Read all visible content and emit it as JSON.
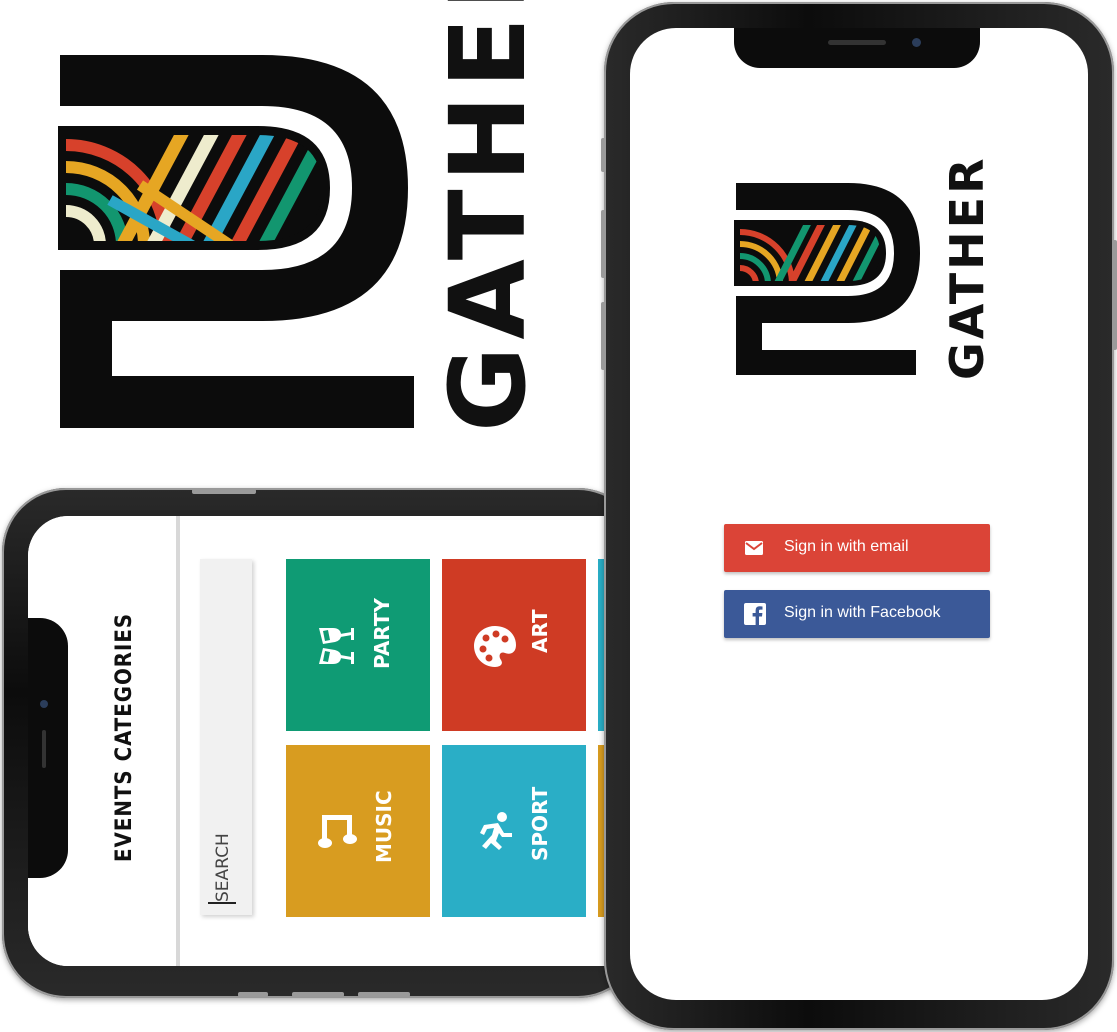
{
  "brand": {
    "logo_word": "GATHER"
  },
  "categories_screen": {
    "title": "EVENTS CATEGORIES",
    "search_placeholder": "SEARCH",
    "tiles": [
      {
        "label": "PARTY",
        "icon": "cheers-glasses-icon",
        "color": "#0f9b74"
      },
      {
        "label": "ART",
        "icon": "paint-palette-icon",
        "color": "#cf3b24"
      },
      {
        "label": "MUSIC",
        "icon": "music-note-icon",
        "color": "#d89c20"
      },
      {
        "label": "SPORT",
        "icon": "running-person-icon",
        "color": "#2aaec6"
      }
    ]
  },
  "login_screen": {
    "logo_word": "GATHER",
    "buttons": [
      {
        "label": "Sign in with email",
        "icon": "mail-icon",
        "color": "#db4437"
      },
      {
        "label": "Sign in with Facebook",
        "icon": "facebook-icon",
        "color": "#3b5998"
      }
    ]
  },
  "colors": {
    "stripe_red": "#d7412b",
    "stripe_yellow": "#e6a623",
    "stripe_green": "#12966f",
    "stripe_cream": "#eeeccd",
    "stripe_blue": "#2aa6c6",
    "logo_black": "#0c0c0c"
  }
}
